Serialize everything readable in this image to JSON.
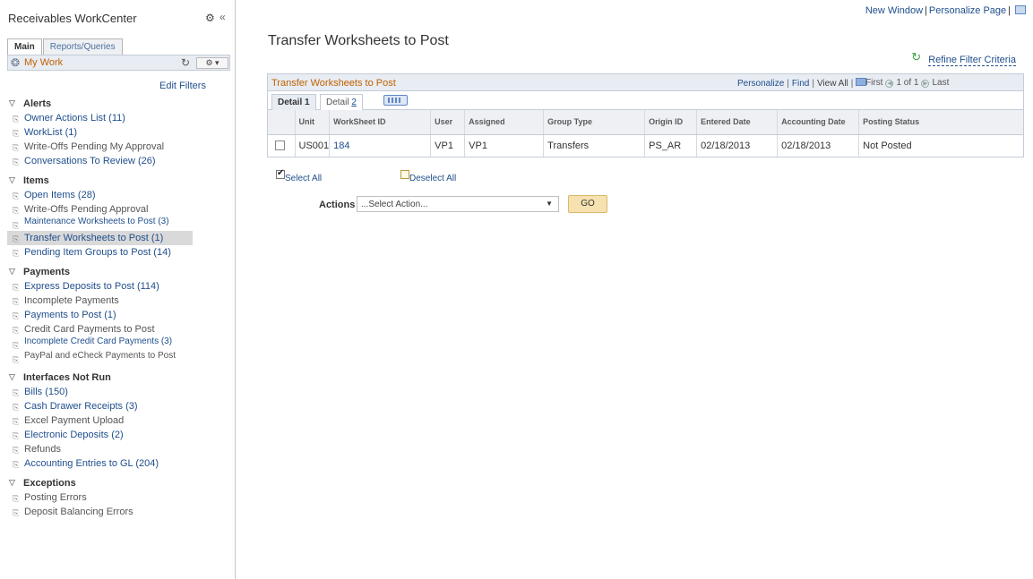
{
  "sidebar": {
    "title": "Receivables WorkCenter",
    "collapse": "«",
    "tabs": [
      "Main",
      "Reports/Queries"
    ],
    "my_work": "My Work",
    "options_label": "⚙ ▾",
    "edit_filters": "Edit Filters",
    "sections": [
      {
        "label": "Alerts",
        "items": [
          {
            "label": "Owner Actions List (11)",
            "link": true
          },
          {
            "label": "WorkList (1)",
            "link": true
          },
          {
            "label": "Write-Offs Pending My Approval",
            "link": false
          },
          {
            "label": "Conversations To Review (26)",
            "link": true
          }
        ]
      },
      {
        "label": "Items",
        "items": [
          {
            "label": "Open Items (28)",
            "link": true
          },
          {
            "label": "Write-Offs Pending Approval",
            "link": false
          },
          {
            "label": "Maintenance Worksheets to Post (3)",
            "link": true,
            "two_line": true
          },
          {
            "label": "Transfer Worksheets to Post (1)",
            "link": true,
            "selected": true
          },
          {
            "label": "Pending Item Groups to Post (14)",
            "link": true
          }
        ]
      },
      {
        "label": "Payments",
        "items": [
          {
            "label": "Express Deposits to Post (114)",
            "link": true
          },
          {
            "label": "Incomplete Payments",
            "link": false
          },
          {
            "label": "Payments to Post (1)",
            "link": true
          },
          {
            "label": "Credit Card Payments to Post",
            "link": false
          },
          {
            "label": "Incomplete Credit Card Payments (3)",
            "link": true,
            "two_line": true
          },
          {
            "label": "PayPal and eCheck Payments to Post",
            "link": false,
            "two_line": true
          }
        ]
      },
      {
        "label": "Interfaces Not Run",
        "items": [
          {
            "label": "Bills (150)",
            "link": true
          },
          {
            "label": "Cash Drawer Receipts (3)",
            "link": true
          },
          {
            "label": "Excel Payment Upload",
            "link": false
          },
          {
            "label": "Electronic Deposits (2)",
            "link": true
          },
          {
            "label": "Refunds",
            "link": false
          },
          {
            "label": "Accounting Entries to GL (204)",
            "link": true
          }
        ]
      },
      {
        "label": "Exceptions",
        "items": [
          {
            "label": "Posting Errors",
            "link": false
          },
          {
            "label": "Deposit Balancing Errors",
            "link": false
          }
        ]
      }
    ]
  },
  "top_links": {
    "new_window": "New Window",
    "personalize_page": "Personalize Page"
  },
  "page_title": "Transfer Worksheets to Post",
  "refine_filter": "Refine Filter Criteria",
  "grid": {
    "title": "Transfer Worksheets to Post",
    "tools": {
      "personalize": "Personalize",
      "find": "Find",
      "view_all": "View All"
    },
    "nav": {
      "first": "First",
      "range": "1 of 1",
      "last": "Last"
    },
    "tabs": {
      "detail1": "Detail 1",
      "detail2_prefix": "Detail ",
      "detail2_num": "2"
    },
    "columns": [
      "",
      "Unit",
      "WorkSheet ID",
      "User",
      "Assigned",
      "Group Type",
      "Origin ID",
      "Entered Date",
      "Accounting Date",
      "Posting Status"
    ],
    "rows": [
      {
        "unit": "US001",
        "worksheet_id": "184",
        "user": "VP1",
        "assigned": "VP1",
        "group_type": "Transfers",
        "origin_id": "PS_AR",
        "entered_date": "02/18/2013",
        "accounting_date": "02/18/2013",
        "posting_status": "Not Posted"
      }
    ]
  },
  "select_all": "Select All",
  "deselect_all": "Deselect All",
  "actions": {
    "label": "Actions",
    "value": "...Select Action...",
    "go": "GO"
  },
  "colors": {
    "accent_orange": "#c06100",
    "link_blue": "#1f4e8c",
    "header_bg": "#e8ecf3",
    "go_button": "#f6e2b0"
  }
}
